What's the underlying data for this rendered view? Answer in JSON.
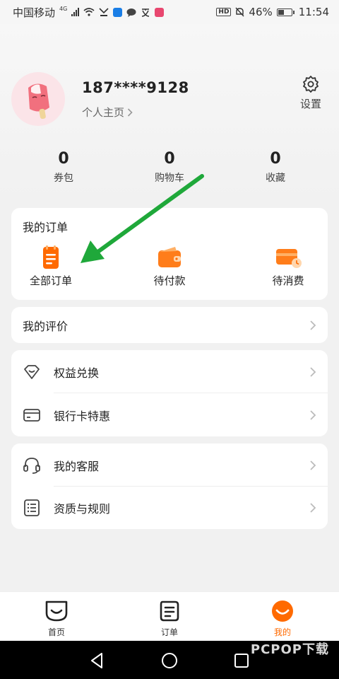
{
  "status_bar": {
    "carrier": "中国移动",
    "network": "4G",
    "hd_label": "HD",
    "battery": "46%",
    "time": "11:54"
  },
  "profile": {
    "phone": "187****9128",
    "homepage_link": "个人主页",
    "settings_label": "设置"
  },
  "stats": [
    {
      "value": "0",
      "label": "券包"
    },
    {
      "value": "0",
      "label": "购物车"
    },
    {
      "value": "0",
      "label": "收藏"
    }
  ],
  "orders": {
    "title": "我的订单",
    "items": [
      {
        "label": "全部订单",
        "icon": "clipboard-icon"
      },
      {
        "label": "待付款",
        "icon": "wallet-icon"
      },
      {
        "label": "待消费",
        "icon": "card-clock-icon"
      }
    ]
  },
  "menu": {
    "reviews": "我的评价",
    "benefits_exchange": "权益兑换",
    "bank_card_offers": "银行卡特惠",
    "customer_service": "我的客服",
    "qualifications_rules": "资质与规则"
  },
  "tab_bar": {
    "tabs": [
      {
        "label": "首页",
        "icon": "home-smile-icon"
      },
      {
        "label": "订单",
        "icon": "order-list-icon"
      },
      {
        "label": "我的",
        "icon": "profile-face-icon"
      }
    ],
    "active": "我的"
  },
  "watermark": "PCPOP下载",
  "colors": {
    "accent": "#ff6a00",
    "annotation_arrow": "#1fa83a",
    "background": "#f1f1f1"
  }
}
